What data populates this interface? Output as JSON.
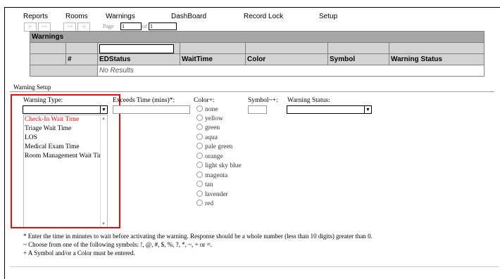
{
  "menu": [
    "Reports",
    "Rooms",
    "Warnings",
    "DashBoard",
    "Record Lock",
    "Setup"
  ],
  "pager": {
    "first": "|<",
    "prev": "<<",
    "next": ">>",
    "last": ">|",
    "page_label": "Page",
    "page_value": "1",
    "of_label": "of",
    "of_value": "1"
  },
  "grid": {
    "caption": "Warnings",
    "headers": [
      "",
      "#",
      "EDStatus",
      "WaitTime",
      "Color",
      "Symbol",
      "Warning Status"
    ],
    "filter_value": "",
    "no_results": "No Results"
  },
  "setup": {
    "legend": "Warning Setup",
    "warning_type_label": "Warning Type:",
    "warning_type_value": "",
    "warning_type_options": [
      "Check-In Wait Time",
      "Triage Wait Time",
      "LOS",
      "Medical Exam Time",
      "Room Management Wait Time"
    ],
    "warning_type_highlighted": "Check-In Wait Time",
    "exceeds_label": "Exceeds Time (mins)*:",
    "exceeds_value": "",
    "color_label": "Color+:",
    "colors": [
      "none",
      "yellow",
      "green",
      "aqua",
      "pale green",
      "orange",
      "light sky blue",
      "magenta",
      "tan",
      "lavender",
      "red"
    ],
    "symbol_label": "Symbol~+:",
    "symbol_value": "",
    "status_label": "Warning Status:",
    "status_value": ""
  },
  "notes": [
    "* Enter the time in minutes to wait before activating the warning. Response should be a whole number (less than 10 digits) greater than 0.",
    "~ Choose from one of the following symbols: !, @, #, $, %, ?, *, ~, + or =.",
    "+ A Symbol and/or a Color must be entered."
  ],
  "colors_ui": {
    "highlight_border": "#e01010",
    "selected_option": "#e01010",
    "header_bg": "#d4d4d4",
    "caption_bg": "#a6a6a6"
  }
}
